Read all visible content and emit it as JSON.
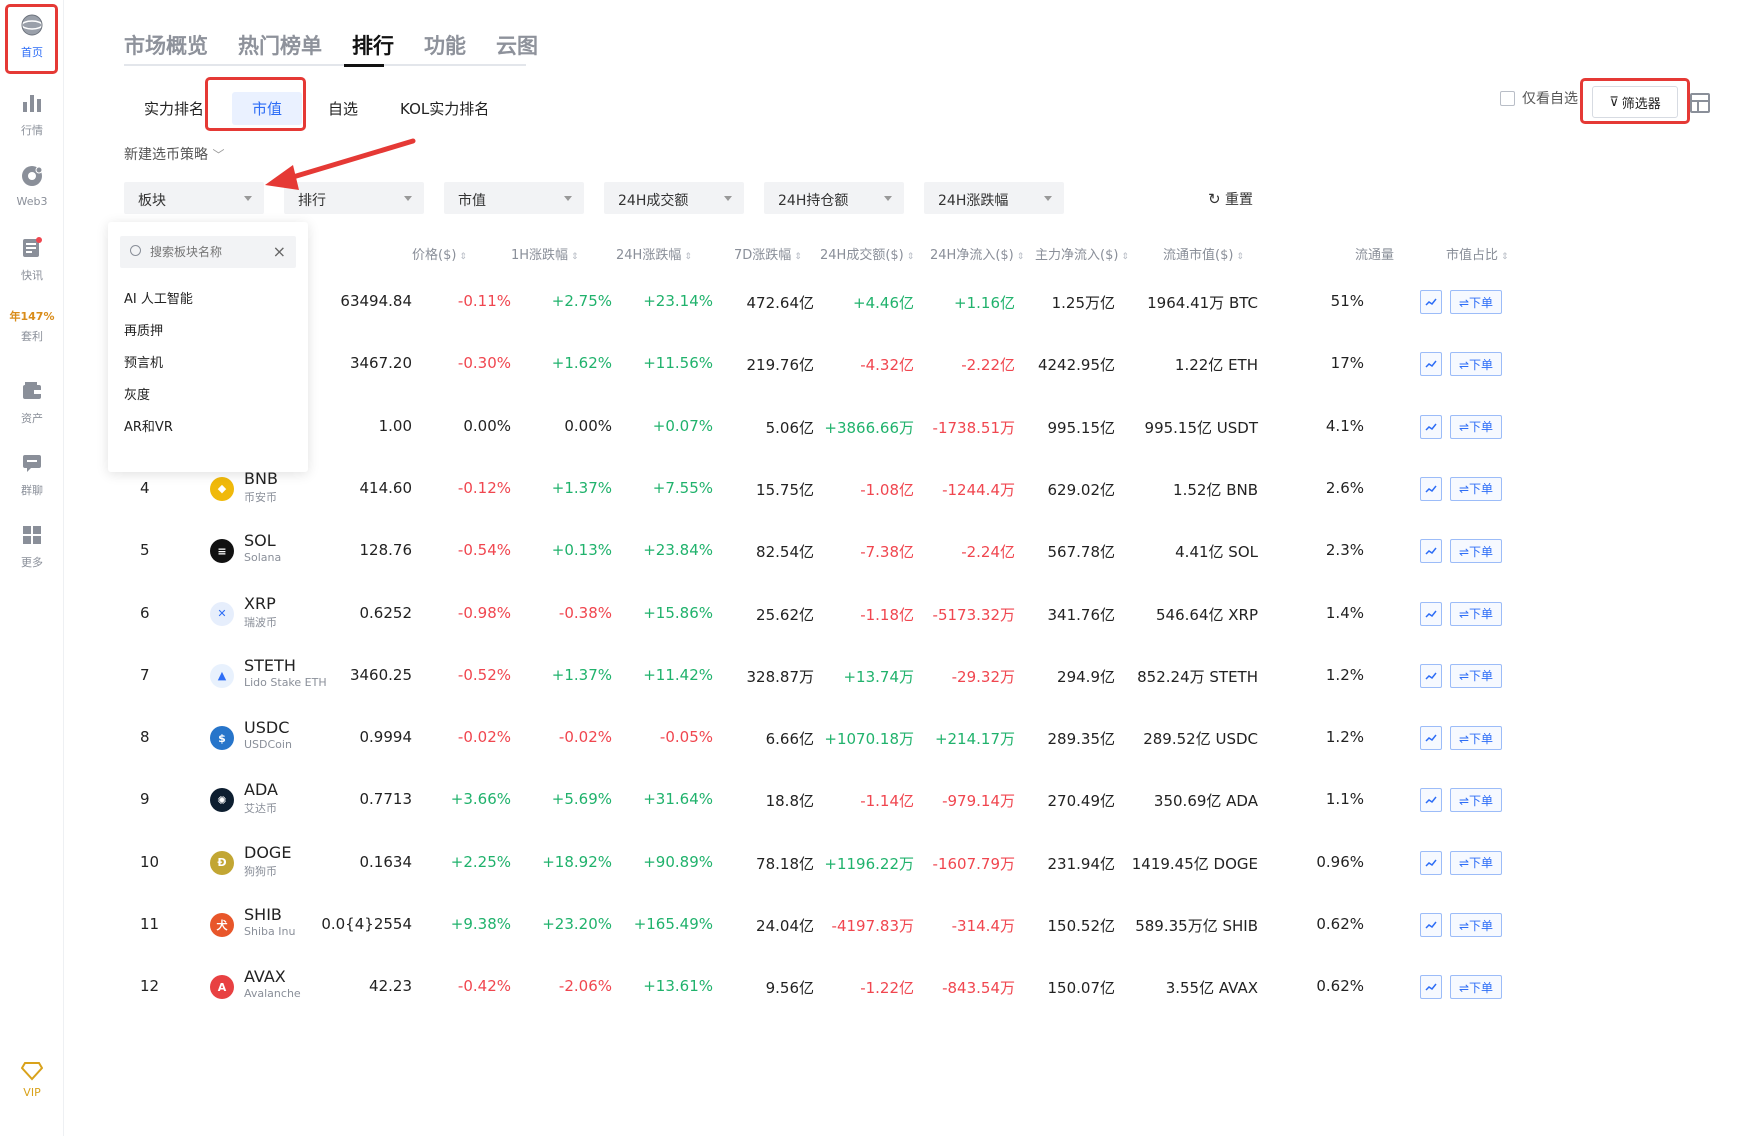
{
  "sidebar": {
    "items": [
      {
        "label": "首页",
        "icon": "globe-icon"
      },
      {
        "label": "行情",
        "icon": "bar-chart-icon"
      },
      {
        "label": "Web3",
        "icon": "web3-icon"
      },
      {
        "label": "快讯",
        "icon": "news-icon"
      },
      {
        "label": "套利",
        "icon": "arbitrage-icon",
        "promo": "年147%"
      },
      {
        "label": "资产",
        "icon": "wallet-icon"
      },
      {
        "label": "群聊",
        "icon": "chat-icon"
      },
      {
        "label": "更多",
        "icon": "grid-icon"
      }
    ],
    "vip": "VIP"
  },
  "top_tabs": [
    "市场概览",
    "热门榜单",
    "排行",
    "功能",
    "云图"
  ],
  "sub_tabs": [
    "实力排名",
    "市值",
    "自选",
    "KOL实力排名"
  ],
  "strategy_label": "新建选币策略",
  "only_fav_label": "仅看自选",
  "filter_button": "筛选器",
  "filters": [
    "板块",
    "排行",
    "市值",
    "24H成交额",
    "24H持仓额",
    "24H涨跌幅"
  ],
  "reset_label": "重置",
  "dropdown": {
    "placeholder": "搜索板块名称",
    "items": [
      "AI 人工智能",
      "再质押",
      "预言机",
      "灰度",
      "AR和VR"
    ]
  },
  "table": {
    "headers": [
      "价格($)",
      "1H涨跌幅",
      "24H涨跌幅",
      "7D涨跌幅",
      "24H成交额($)",
      "24H净流入($)",
      "主力净流入($)",
      "流通市值($)",
      "流通量",
      "市值占比"
    ],
    "action_labels": {
      "trade": "⇌下单"
    },
    "rows": [
      {
        "rank": "",
        "symbol": "",
        "name": "",
        "price": "63494.84",
        "h1": "-0.11%",
        "h24": "+2.75%",
        "d7": "+23.14%",
        "vol": "472.64亿",
        "net": "+4.46亿",
        "main": "+1.16亿",
        "mcap": "1.25万亿",
        "supply": "1964.41万 BTC",
        "share": "51%"
      },
      {
        "rank": "",
        "symbol": "",
        "name": "",
        "price": "3467.20",
        "h1": "-0.30%",
        "h24": "+1.62%",
        "d7": "+11.56%",
        "vol": "219.76亿",
        "net": "-4.32亿",
        "main": "-2.22亿",
        "mcap": "4242.95亿",
        "supply": "1.22亿 ETH",
        "share": "17%"
      },
      {
        "rank": "",
        "symbol": "",
        "name": "",
        "price": "1.00",
        "h1": "0.00%",
        "h24": "0.00%",
        "d7": "+0.07%",
        "vol": "5.06亿",
        "net": "+3866.66万",
        "main": "-1738.51万",
        "mcap": "995.15亿",
        "supply": "995.15亿 USDT",
        "share": "4.1%"
      },
      {
        "rank": "4",
        "symbol": "BNB",
        "name": "币安币",
        "icon_color": "#f0b90b",
        "icon_text": "◆",
        "price": "414.60",
        "h1": "-0.12%",
        "h24": "+1.37%",
        "d7": "+7.55%",
        "vol": "15.75亿",
        "net": "-1.08亿",
        "main": "-1244.4万",
        "mcap": "629.02亿",
        "supply": "1.52亿 BNB",
        "share": "2.6%"
      },
      {
        "rank": "5",
        "symbol": "SOL",
        "name": "Solana",
        "icon_color": "#111111",
        "icon_text": "≡",
        "price": "128.76",
        "h1": "-0.54%",
        "h24": "+0.13%",
        "d7": "+23.84%",
        "vol": "82.54亿",
        "net": "-7.38亿",
        "main": "-2.24亿",
        "mcap": "567.78亿",
        "supply": "4.41亿 SOL",
        "share": "2.3%"
      },
      {
        "rank": "6",
        "symbol": "XRP",
        "name": "瑞波币",
        "icon_color": "#e6eefc",
        "icon_text": "✕",
        "price": "0.6252",
        "h1": "-0.98%",
        "h24": "-0.38%",
        "d7": "+15.86%",
        "vol": "25.62亿",
        "net": "-1.18亿",
        "main": "-5173.32万",
        "mcap": "341.76亿",
        "supply": "546.64亿 XRP",
        "share": "1.4%"
      },
      {
        "rank": "7",
        "symbol": "STETH",
        "name": "Lido Stake ETH",
        "icon_color": "#e8f1fd",
        "icon_text": "▲",
        "price": "3460.25",
        "h1": "-0.52%",
        "h24": "+1.37%",
        "d7": "+11.42%",
        "vol": "328.87万",
        "net": "+13.74万",
        "main": "-29.32万",
        "mcap": "294.9亿",
        "supply": "852.24万 STETH",
        "share": "1.2%"
      },
      {
        "rank": "8",
        "symbol": "USDC",
        "name": "USDCoin",
        "icon_color": "#2775ca",
        "icon_text": "$",
        "price": "0.9994",
        "h1": "-0.02%",
        "h24": "-0.02%",
        "d7": "-0.05%",
        "vol": "6.66亿",
        "net": "+1070.18万",
        "main": "+214.17万",
        "mcap": "289.35亿",
        "supply": "289.52亿 USDC",
        "share": "1.2%"
      },
      {
        "rank": "9",
        "symbol": "ADA",
        "name": "艾达币",
        "icon_color": "#0d1e30",
        "icon_text": "✺",
        "price": "0.7713",
        "h1": "+3.66%",
        "h24": "+5.69%",
        "d7": "+31.64%",
        "vol": "18.8亿",
        "net": "-1.14亿",
        "main": "-979.14万",
        "mcap": "270.49亿",
        "supply": "350.69亿 ADA",
        "share": "1.1%"
      },
      {
        "rank": "10",
        "symbol": "DOGE",
        "name": "狗狗币",
        "icon_color": "#c2a633",
        "icon_text": "Ð",
        "price": "0.1634",
        "h1": "+2.25%",
        "h24": "+18.92%",
        "d7": "+90.89%",
        "vol": "78.18亿",
        "net": "+1196.22万",
        "main": "-1607.79万",
        "mcap": "231.94亿",
        "supply": "1419.45亿 DOGE",
        "share": "0.96%"
      },
      {
        "rank": "11",
        "symbol": "SHIB",
        "name": "Shiba Inu",
        "icon_color": "#e8562a",
        "icon_text": "犬",
        "price": "0.0{4}2554",
        "h1": "+9.38%",
        "h24": "+23.20%",
        "d7": "+165.49%",
        "vol": "24.04亿",
        "net": "-4197.83万",
        "main": "-314.4万",
        "mcap": "150.52亿",
        "supply": "589.35万亿 SHIB",
        "share": "0.62%"
      },
      {
        "rank": "12",
        "symbol": "AVAX",
        "name": "Avalanche",
        "icon_color": "#e84142",
        "icon_text": "A",
        "price": "42.23",
        "h1": "-0.42%",
        "h24": "-2.06%",
        "d7": "+13.61%",
        "vol": "9.56亿",
        "net": "-1.22亿",
        "main": "-843.54万",
        "mcap": "150.07亿",
        "supply": "3.55亿 AVAX",
        "share": "0.62%"
      }
    ]
  },
  "colors": {
    "accent": "#2d6df6",
    "positive": "#20b26c",
    "negative": "#f0464f",
    "annotation": "#e53935"
  }
}
